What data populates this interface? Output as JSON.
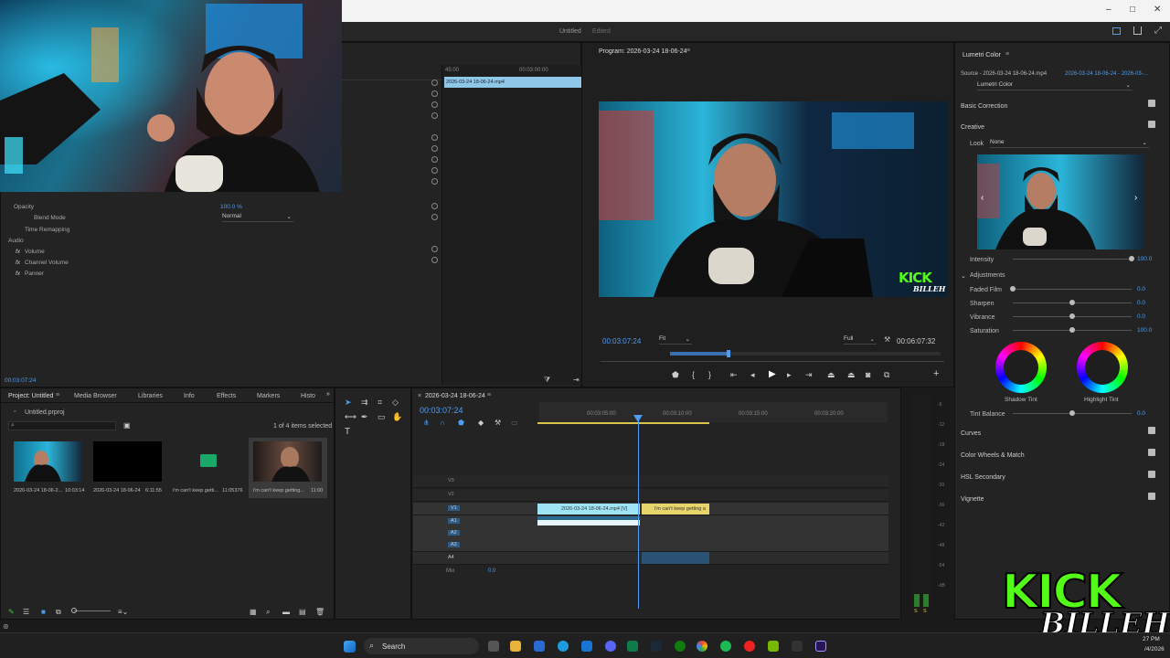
{
  "window": {
    "title": "Untitled",
    "edited": "Edited"
  },
  "effect_controls": {
    "opacity_label": "Opacity",
    "opacity_value": "100.0 %",
    "blend_label": "Blend Mode",
    "blend_value": "Normal",
    "time_remapping": "Time Remapping",
    "audio_label": "Audio",
    "volume": "Volume",
    "channel_volume": "Channel Volume",
    "panner": "Panner",
    "timecode": "00:03:07:24",
    "mini_timeline_start": "45:00",
    "mini_timeline_mid": "00:03:00:00",
    "mini_clip": "2026-03-24 18-06-24.mp4"
  },
  "program": {
    "title": "Program: 2026-03-24 18-06-24",
    "timecode": "00:03:07:24",
    "fit": "Fit",
    "full": "Full",
    "duration": "00:06:07:32"
  },
  "overlay": {
    "logo_top": "KICK",
    "logo_bottom": "BILLEH"
  },
  "project": {
    "tabs": [
      "Project: Untitled",
      "Media Browser",
      "Libraries",
      "Info",
      "Effects",
      "Markers",
      "Histo"
    ],
    "file": "Untitled.prproj",
    "selection": "1 of 4 items selected",
    "items": [
      {
        "name": "2026-03-24 18-06-2...",
        "dur": "10:03:14"
      },
      {
        "name": "2026-03-24 18-06-24",
        "dur": "6:11:55"
      },
      {
        "name": "i'm can't keep getti...",
        "dur": "11:05376"
      },
      {
        "name": "i'm can't keep getting...",
        "dur": "11:00"
      }
    ]
  },
  "timeline": {
    "title": "2026-03-24 18-06-24",
    "timecode": "00:03:07:24",
    "ruler": [
      "00:03:05:00",
      "00:03:10:00",
      "00:03:15:00",
      "00:03:20:00"
    ],
    "tracks_video": [
      "V3",
      "V2",
      "V1"
    ],
    "tracks_audio": [
      "A1",
      "A2",
      "A3",
      "A4"
    ],
    "clip_v1": "2026-03-24 18-06-24.mp4 [V]",
    "clip_v1b": "i'm can't keep getting a",
    "mix_label": "Mix",
    "mix_value": "0.0",
    "meter_labels": [
      "-6",
      "-12",
      "-18",
      "-24",
      "-30",
      "-36",
      "-42",
      "-48",
      "-54",
      "-dB"
    ],
    "meter_bottom": [
      "S",
      "S"
    ]
  },
  "lumetri": {
    "title": "Lumetri Color",
    "source": "Source - 2026-03-24 18-06-24.mp4",
    "source_link": "2026-03-24 18-06-24 - 2026-03-...",
    "effect": "Lumetri Color",
    "basic_correction": "Basic Correction",
    "creative": "Creative",
    "look_label": "Look",
    "look_value": "None",
    "intensity_label": "Intensity",
    "intensity_value": "100.0",
    "adjustments": "Adjustments",
    "faded_film": "Faded Film",
    "faded_film_value": "0.0",
    "sharpen": "Sharpen",
    "sharpen_value": "0.0",
    "vibrance": "Vibrance",
    "vibrance_value": "0.0",
    "saturation": "Saturation",
    "saturation_value": "100.0",
    "shadow_tint": "Shadow Tint",
    "highlight_tint": "Highlight Tint",
    "tint_balance": "Tint Balance",
    "tint_balance_value": "0.0",
    "curves": "Curves",
    "color_wheels": "Color Wheels & Match",
    "hsl": "HSL Secondary",
    "vignette": "Vignette"
  },
  "taskbar": {
    "search": "Search",
    "time": "27 PM",
    "date": "/4/2026"
  },
  "colors": {
    "accent": "#4f9cf0",
    "kick_green": "#53fc18",
    "clip_cyan": "#9fe4f6",
    "clip_yellow": "#e7d46b"
  }
}
